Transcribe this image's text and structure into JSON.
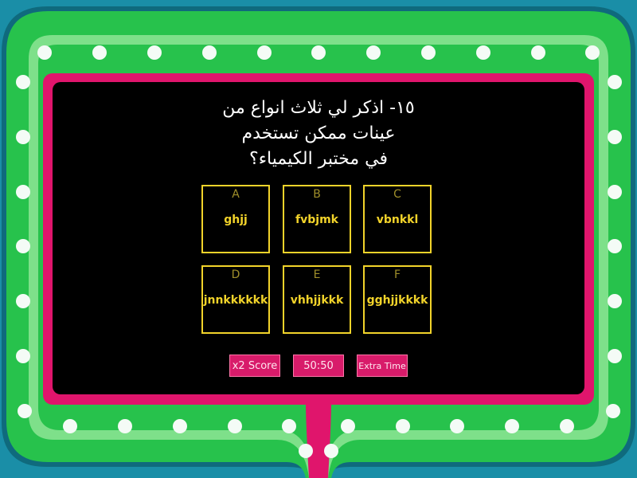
{
  "question": {
    "text": "١٥- اذكر لي ثلاث انواع من\nعينات ممكن تستخدم\nفي مختبر الكيمياء؟"
  },
  "cards": [
    {
      "letter": "A",
      "answer": "ghjj"
    },
    {
      "letter": "B",
      "answer": "fvbjmk"
    },
    {
      "letter": "C",
      "answer": "vbnkkl"
    },
    {
      "letter": "D",
      "answer": "jnnkkkkkk"
    },
    {
      "letter": "E",
      "answer": "vhhjjkkk"
    },
    {
      "letter": "F",
      "answer": "gghjjkkkk"
    }
  ],
  "powerups": {
    "double_score": "x2 Score",
    "fifty_fifty": "50:50",
    "extra_time": "Extra Time"
  },
  "colors": {
    "background": "#1a8ea7",
    "frame_green": "#27c24c",
    "frame_light_green": "#7ee08a",
    "frame_border": "#0f6a7d",
    "screen_border": "#e0156c",
    "screen": "#000000",
    "card_border": "#f2d32a",
    "card_letter": "#a08f2a",
    "button": "#d81b6a"
  },
  "icons": {
    "frame_lights": "light-bulb-dot"
  }
}
